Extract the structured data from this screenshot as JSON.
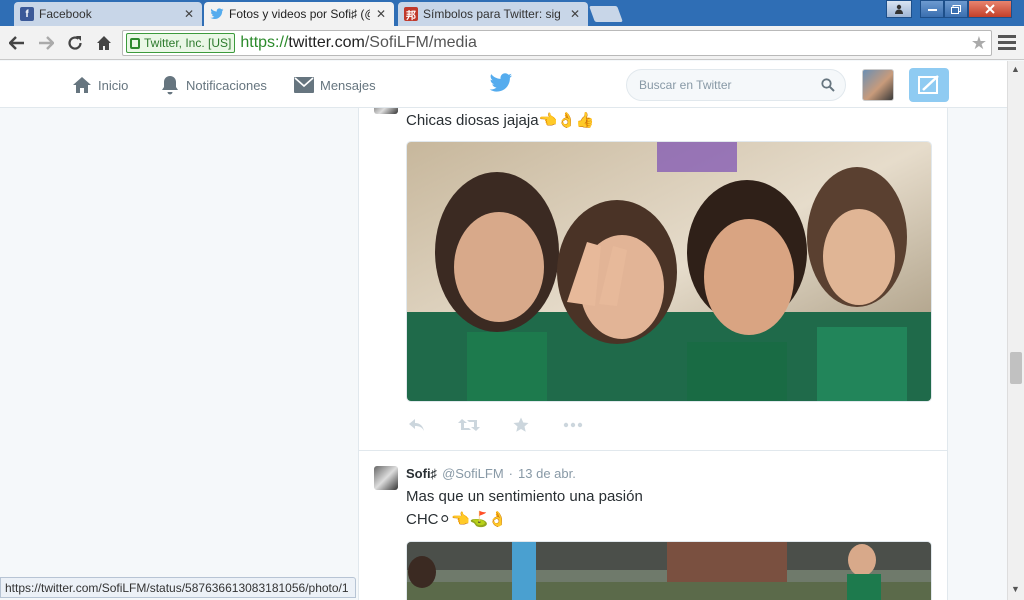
{
  "browser": {
    "tabs": [
      {
        "label": "Facebook",
        "icon": "facebook-icon",
        "active": false
      },
      {
        "label": "Fotos y videos por Sofi♯ (@",
        "icon": "twitter-icon",
        "active": true
      },
      {
        "label": "Símbolos para Twitter: sig",
        "icon": "symbols-site-icon",
        "active": false
      }
    ],
    "close_glyph": "✕",
    "security_label": "Twitter, Inc. [US]",
    "url_scheme": "https://",
    "url_host": "twitter.com",
    "url_path": "/SofiLFM/media",
    "status_url": "https://twitter.com/SofiLFM/status/587636613083181056/photo/1"
  },
  "header": {
    "nav": [
      {
        "label": "Inicio",
        "icon": "home-icon"
      },
      {
        "label": "Notificaciones",
        "icon": "bell-icon"
      },
      {
        "label": "Mensajes",
        "icon": "envelope-icon"
      }
    ],
    "search_placeholder": "Buscar en Twitter",
    "accent": "#55acee",
    "tweet_button_color": "#8fcbf2"
  },
  "tweets": [
    {
      "text": "Chicas diosas jajaja👈👌👍",
      "photo_alt": "Foto de chicas del equipo"
    },
    {
      "name": "Sofi♯",
      "handle": "@SofiLFM",
      "separator": "·",
      "date": "13 de abr.",
      "text_line1": "Mas que un sentimiento una pasión",
      "text_line2": "CHC⚪👈⛳👌"
    }
  ]
}
